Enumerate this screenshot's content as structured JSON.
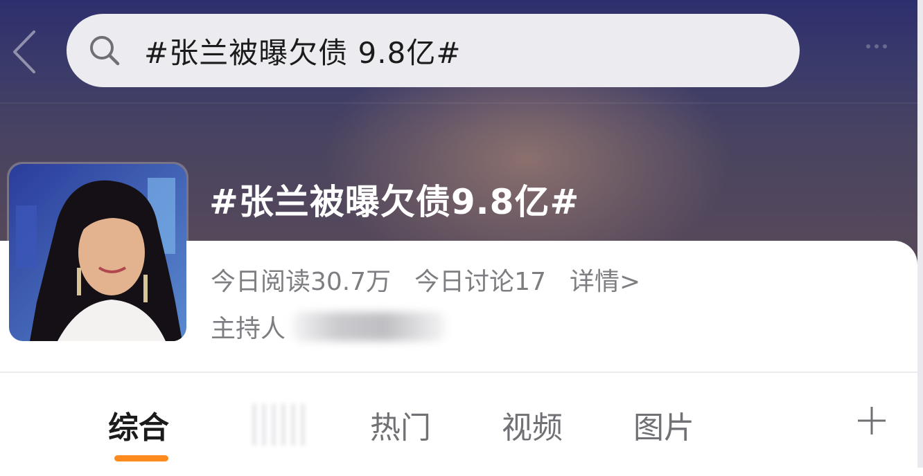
{
  "search": {
    "query": "#张兰被曝欠债 9.8亿#"
  },
  "topic": {
    "title": "#张兰被曝欠债9.8亿#",
    "reads": "今日阅读30.7万",
    "discussions": "今日讨论17",
    "details_link": "详情>",
    "host_label": "主持人"
  },
  "tabs": [
    {
      "label": "综合",
      "active": true
    },
    {
      "label": "热门",
      "active": false
    },
    {
      "label": "视频",
      "active": false
    },
    {
      "label": "图片",
      "active": false
    }
  ],
  "colors": {
    "accent": "#ff8a1e",
    "hero_top": "#2e2f6e",
    "text_muted": "#7d7d82"
  },
  "icons": {
    "back": "chevron-left-icon",
    "search": "search-icon",
    "add": "plus-icon",
    "more": "more-dots-icon"
  }
}
